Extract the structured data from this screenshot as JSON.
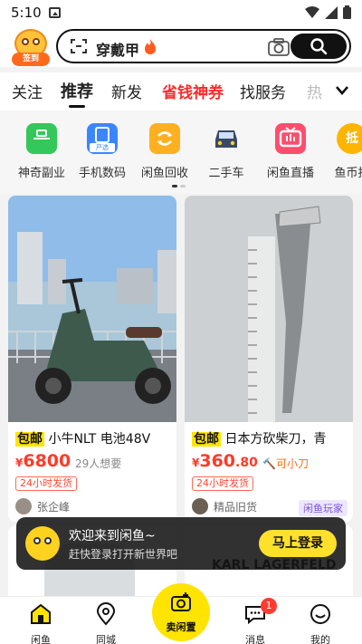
{
  "status_bar": {
    "time": "5:10"
  },
  "header": {
    "signin_label": "签到",
    "search_keyword": "穿戴甲"
  },
  "tabs": [
    {
      "label": "关注"
    },
    {
      "label": "推荐"
    },
    {
      "label": "新发"
    },
    {
      "label": "省钱神券"
    },
    {
      "label": "找服务"
    },
    {
      "label": "热"
    }
  ],
  "categories": [
    {
      "label": "神奇副业",
      "icon": "briefcase-icon",
      "color": "#34c759"
    },
    {
      "label": "手机数码",
      "icon": "phone-icon",
      "color": "#3a86ff",
      "badge": "严选"
    },
    {
      "label": "闲鱼回收",
      "icon": "recycle-icon",
      "color": "#ffb020"
    },
    {
      "label": "二手车",
      "icon": "car-icon",
      "color": "#3a4a66"
    },
    {
      "label": "闲鱼直播",
      "icon": "tv-icon",
      "color": "#ff4d6d"
    },
    {
      "label": "鱼币抵",
      "icon": "coin-icon",
      "color": "#ffb400",
      "glyph": "抵"
    }
  ],
  "cards": [
    {
      "tag": "包邮",
      "title": "小牛NLT 电池48V",
      "price_currency": "¥",
      "price_int": "6800",
      "price_dec": "",
      "want": "29人想要",
      "ship": "24小时发货",
      "seller": "张企峰"
    },
    {
      "tag": "包邮",
      "title": "日本方砍柴刀，青",
      "price_currency": "¥",
      "price_int": "360",
      "price_dec": ".80",
      "extra_tag": "可小刀",
      "ship": "24小时发货",
      "seller": "精品旧货",
      "seller_badge": "闲鱼玩家"
    }
  ],
  "peek": {
    "right_text": "KARL LAGERFELD"
  },
  "banner": {
    "line1": "欢迎来到闲鱼~",
    "line2": "赶快登录打开新世界吧",
    "button": "马上登录"
  },
  "nav": [
    {
      "label": "闲鱼"
    },
    {
      "label": "同城"
    },
    {
      "label": "卖闲置"
    },
    {
      "label": "消息",
      "badge": "1"
    },
    {
      "label": "我的"
    }
  ],
  "colors": {
    "accent": "#ffe400",
    "price": "#ff3a2a",
    "red_tab": "#ff2a2a"
  }
}
